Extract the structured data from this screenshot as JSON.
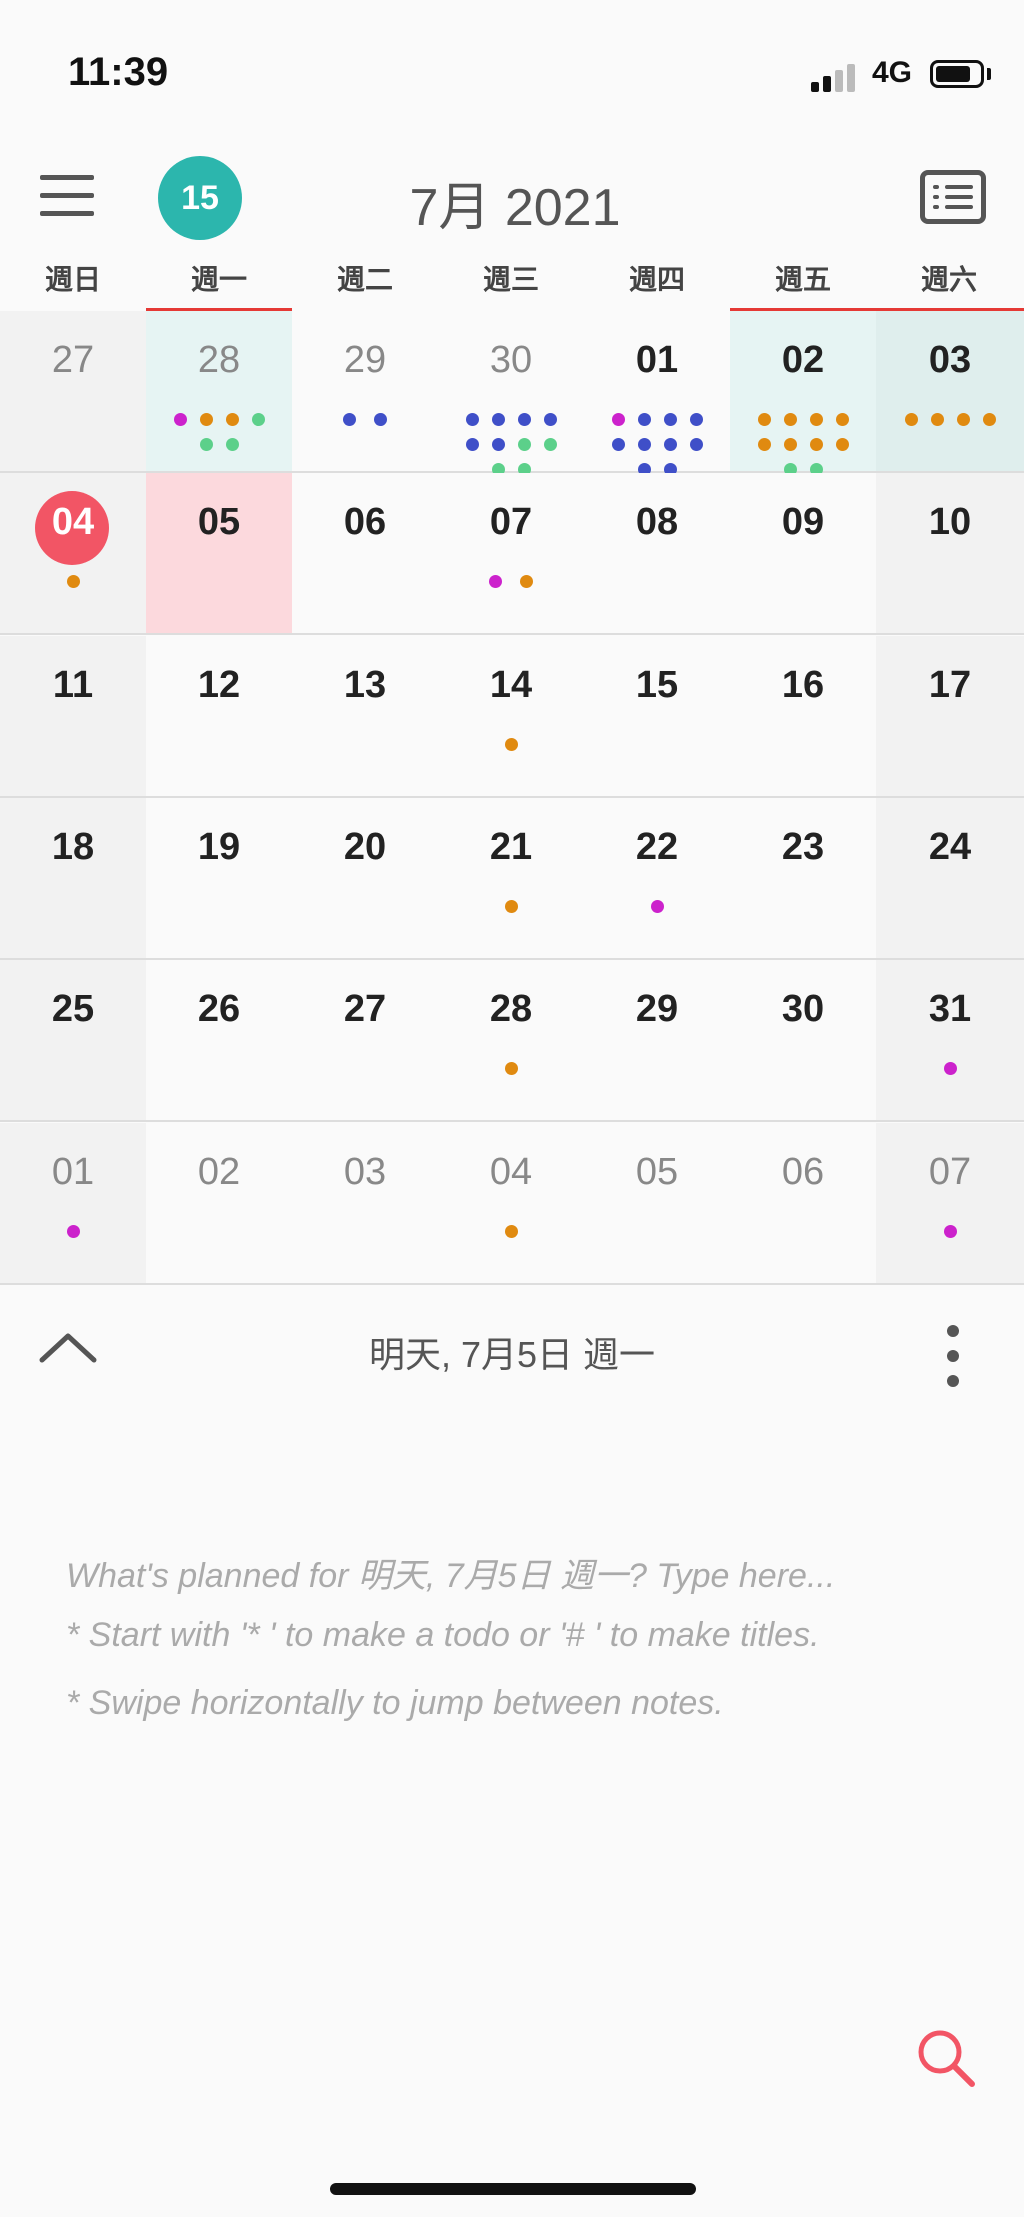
{
  "status": {
    "time": "11:39",
    "network": "4G"
  },
  "header": {
    "today_badge": "15",
    "month_title": "7月 2021"
  },
  "weekdays": [
    "週日",
    "週一",
    "週二",
    "週三",
    "週四",
    "週五",
    "週六"
  ],
  "colors": {
    "accent_teal": "#2cb6ad",
    "today_red": "#f25565",
    "dot_magenta": "#cc22cc",
    "dot_orange": "#e08a10",
    "dot_green": "#5cd08a",
    "dot_blue": "#3f4fc8",
    "week_highlight": "#e6f4f3",
    "selected_day": "#fcd9dd",
    "weekend_bg": "#f2f2f2"
  },
  "weeks": [
    [
      {
        "day": "27",
        "muted": true,
        "dots": []
      },
      {
        "day": "28",
        "muted": true,
        "highlight": true,
        "dots": [
          "magenta",
          "orange",
          "orange",
          "green",
          "green",
          "green"
        ]
      },
      {
        "day": "29",
        "muted": true,
        "dots": [
          "blue",
          "blue"
        ]
      },
      {
        "day": "30",
        "muted": true,
        "dots": [
          "blue",
          "blue",
          "blue",
          "blue",
          "blue",
          "blue",
          "green",
          "green",
          "green",
          "green"
        ]
      },
      {
        "day": "01",
        "dots": [
          "magenta",
          "blue",
          "blue",
          "blue",
          "blue",
          "blue",
          "blue",
          "blue",
          "blue",
          "blue"
        ]
      },
      {
        "day": "02",
        "highlight": true,
        "dots": [
          "orange",
          "orange",
          "orange",
          "orange",
          "orange",
          "orange",
          "orange",
          "orange",
          "green",
          "green"
        ]
      },
      {
        "day": "03",
        "highlight": true,
        "dots": [
          "orange",
          "orange",
          "orange",
          "orange"
        ]
      }
    ],
    [
      {
        "day": "04",
        "today": true,
        "dots": [
          "orange"
        ]
      },
      {
        "day": "05",
        "selected": true,
        "dots": []
      },
      {
        "day": "06",
        "dots": []
      },
      {
        "day": "07",
        "dots": [
          "magenta",
          "orange"
        ]
      },
      {
        "day": "08",
        "dots": []
      },
      {
        "day": "09",
        "dots": []
      },
      {
        "day": "10",
        "dots": []
      }
    ],
    [
      {
        "day": "11",
        "dots": []
      },
      {
        "day": "12",
        "dots": []
      },
      {
        "day": "13",
        "dots": []
      },
      {
        "day": "14",
        "dots": [
          "orange"
        ]
      },
      {
        "day": "15",
        "dots": []
      },
      {
        "day": "16",
        "dots": []
      },
      {
        "day": "17",
        "dots": []
      }
    ],
    [
      {
        "day": "18",
        "dots": []
      },
      {
        "day": "19",
        "dots": []
      },
      {
        "day": "20",
        "dots": []
      },
      {
        "day": "21",
        "dots": [
          "orange"
        ]
      },
      {
        "day": "22",
        "dots": [
          "magenta"
        ]
      },
      {
        "day": "23",
        "dots": []
      },
      {
        "day": "24",
        "dots": []
      }
    ],
    [
      {
        "day": "25",
        "dots": []
      },
      {
        "day": "26",
        "dots": []
      },
      {
        "day": "27",
        "dots": []
      },
      {
        "day": "28",
        "dots": [
          "orange"
        ]
      },
      {
        "day": "29",
        "dots": []
      },
      {
        "day": "30",
        "dots": []
      },
      {
        "day": "31",
        "dots": [
          "magenta"
        ]
      }
    ],
    [
      {
        "day": "01",
        "muted": true,
        "dots": [
          "magenta"
        ]
      },
      {
        "day": "02",
        "muted": true,
        "dots": []
      },
      {
        "day": "03",
        "muted": true,
        "dots": []
      },
      {
        "day": "04",
        "muted": true,
        "dots": [
          "orange"
        ]
      },
      {
        "day": "05",
        "muted": true,
        "dots": []
      },
      {
        "day": "06",
        "muted": true,
        "dots": []
      },
      {
        "day": "07",
        "muted": true,
        "dots": [
          "magenta"
        ]
      }
    ]
  ],
  "day_panel": {
    "title": "明天, 7月5日 週一",
    "hints": [
      "What's planned for 明天, 7月5日 週一? Type here...",
      "* Start with '* ' to make a todo or '# ' to make titles.",
      "* Swipe horizontally to jump between notes."
    ]
  }
}
